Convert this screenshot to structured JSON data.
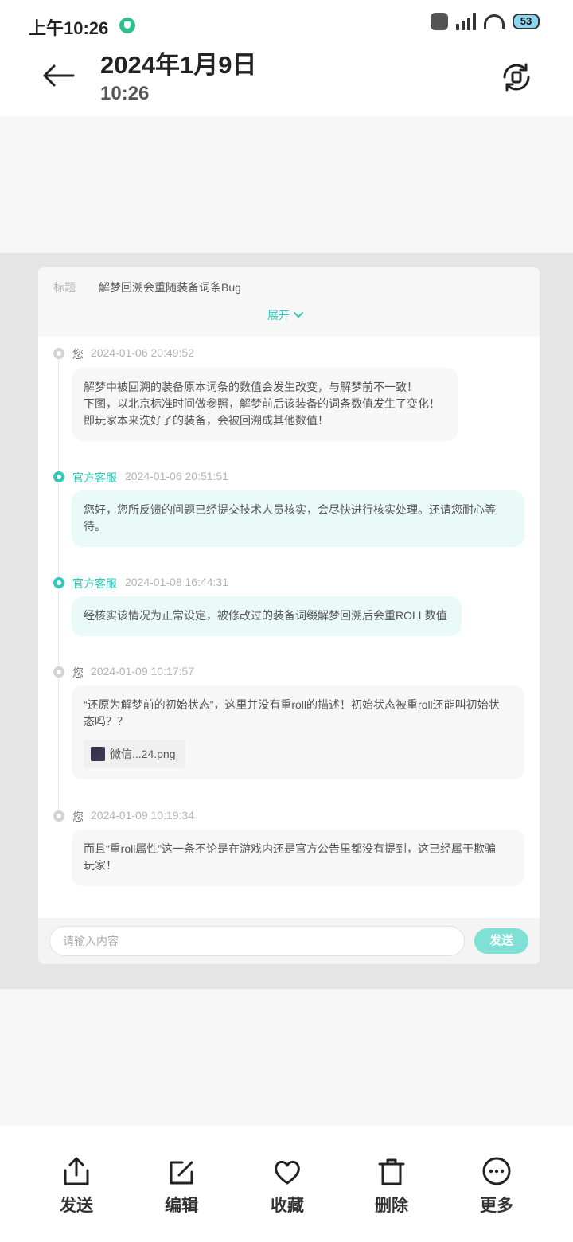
{
  "status_bar": {
    "time": "上午10:26",
    "battery": "53"
  },
  "header": {
    "date": "2024年1月9日",
    "time": "10:26"
  },
  "ticket": {
    "title_label": "标题",
    "title_value": "解梦回溯会重随装备词条Bug",
    "expand_label": "展开",
    "messages": [
      {
        "author": "您",
        "role": "user",
        "timestamp": "2024-01-06 20:49:52",
        "lines": [
          "解梦中被回溯的装备原本词条的数值会发生改变，与解梦前不一致！",
          "下图，以北京标准时间做参照，解梦前后该装备的词条数值发生了变化！",
          "即玩家本来洗好了的装备，会被回溯成其他数值！"
        ]
      },
      {
        "author": "官方客服",
        "role": "staff",
        "timestamp": "2024-01-06 20:51:51",
        "lines": [
          "您好，您所反馈的问题已经提交技术人员核实，会尽快进行核实处理。还请您耐心等",
          "待。"
        ]
      },
      {
        "author": "官方客服",
        "role": "staff",
        "timestamp": "2024-01-08 16:44:31",
        "lines": [
          "经核实该情况为正常设定，被修改过的装备词缀解梦回溯后会重ROLL数值"
        ]
      },
      {
        "author": "您",
        "role": "user",
        "timestamp": "2024-01-09 10:17:57",
        "lines": [
          "“还原为解梦前的初始状态”，这里并没有重roll的描述！初始状态被重roll还能叫初始状",
          "态吗？？"
        ],
        "attachment": "微信...24.png"
      },
      {
        "author": "您",
        "role": "user",
        "timestamp": "2024-01-09 10:19:34",
        "lines": [
          "而且“重roll属性”这一条不论是在游戏内还是官方公告里都没有提到，这已经属于欺骗",
          "玩家！"
        ]
      }
    ],
    "input_placeholder": "请输入内容",
    "send_label": "发送"
  },
  "toolbar": {
    "send": "发送",
    "edit": "编辑",
    "favorite": "收藏",
    "delete": "删除",
    "more": "更多"
  },
  "colors": {
    "accent": "#2ec9b8",
    "send_button": "#7fe0d6"
  }
}
